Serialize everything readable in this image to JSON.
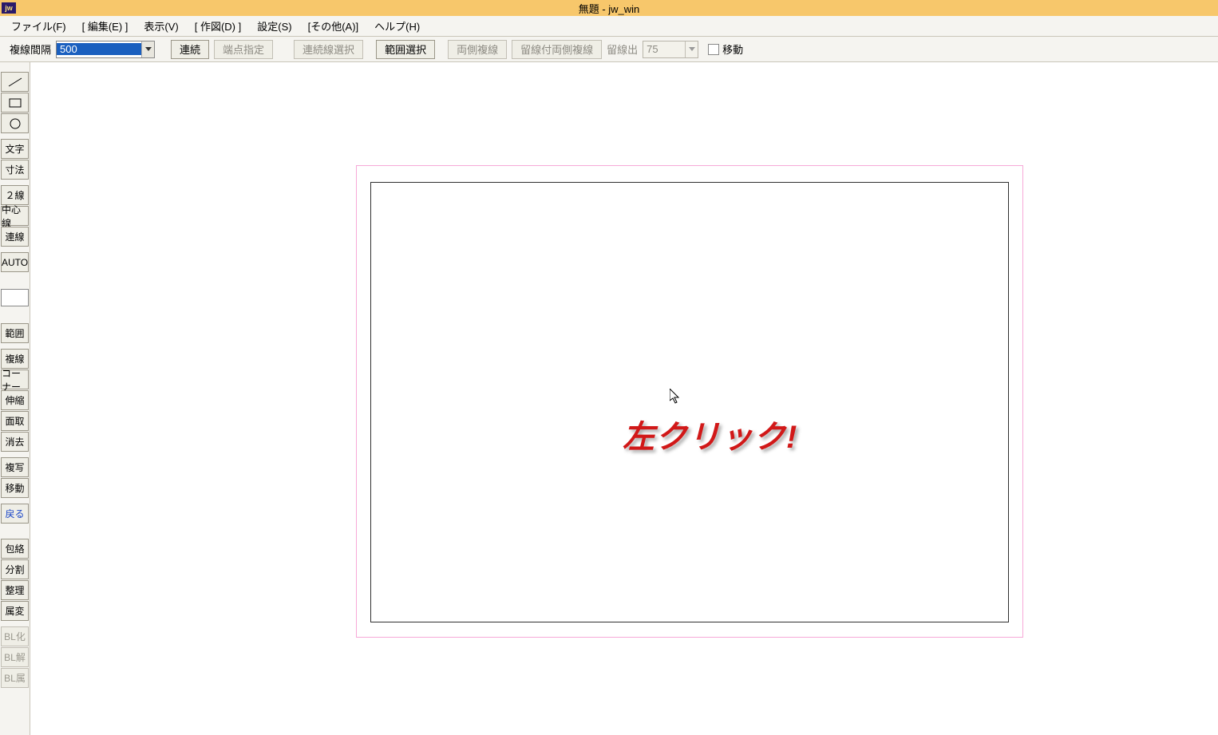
{
  "titlebar": {
    "icon_text": "jw",
    "title": "無題 - jw_win"
  },
  "menubar": {
    "items": [
      "ファイル(F)",
      "[ 編集(E) ]",
      "表示(V)",
      "[ 作図(D) ]",
      "設定(S)",
      "[その他(A)]",
      "ヘルプ(H)"
    ]
  },
  "optbar": {
    "spacing_label": "複線間隔",
    "spacing_value": "500",
    "btn_renzoku": "連続",
    "btn_tanten": "端点指定",
    "btn_renzokusen": "連続線選択",
    "btn_hanisentaku": "範囲選択",
    "btn_ryogawa": "両側複線",
    "btn_tomesen_ryogawa": "留線付両側複線",
    "tomesen_label": "留線出",
    "tomesen_value": "75",
    "chk_move_label": "移動"
  },
  "left_tools": {
    "group1": [
      {
        "name": "line-tool",
        "icon": "line"
      },
      {
        "name": "rect-tool",
        "icon": "rect"
      },
      {
        "name": "circle-tool",
        "icon": "circle"
      }
    ],
    "group2": [
      "文字",
      "寸法"
    ],
    "group3": [
      "２線",
      "中心線",
      "連線"
    ],
    "group4": [
      "AUTO"
    ],
    "group5": [
      "範囲"
    ],
    "group6": [
      "複線",
      "コーナー",
      "伸縮",
      "面取",
      "消去"
    ],
    "group7": [
      "複写",
      "移動"
    ],
    "group8_undo": "戻る",
    "group9": [
      "包絡",
      "分割",
      "整理",
      "属変"
    ],
    "group10_disabled": [
      "BL化",
      "BL解",
      "BL属"
    ]
  },
  "canvas": {
    "annotation_text": "左クリック!"
  }
}
